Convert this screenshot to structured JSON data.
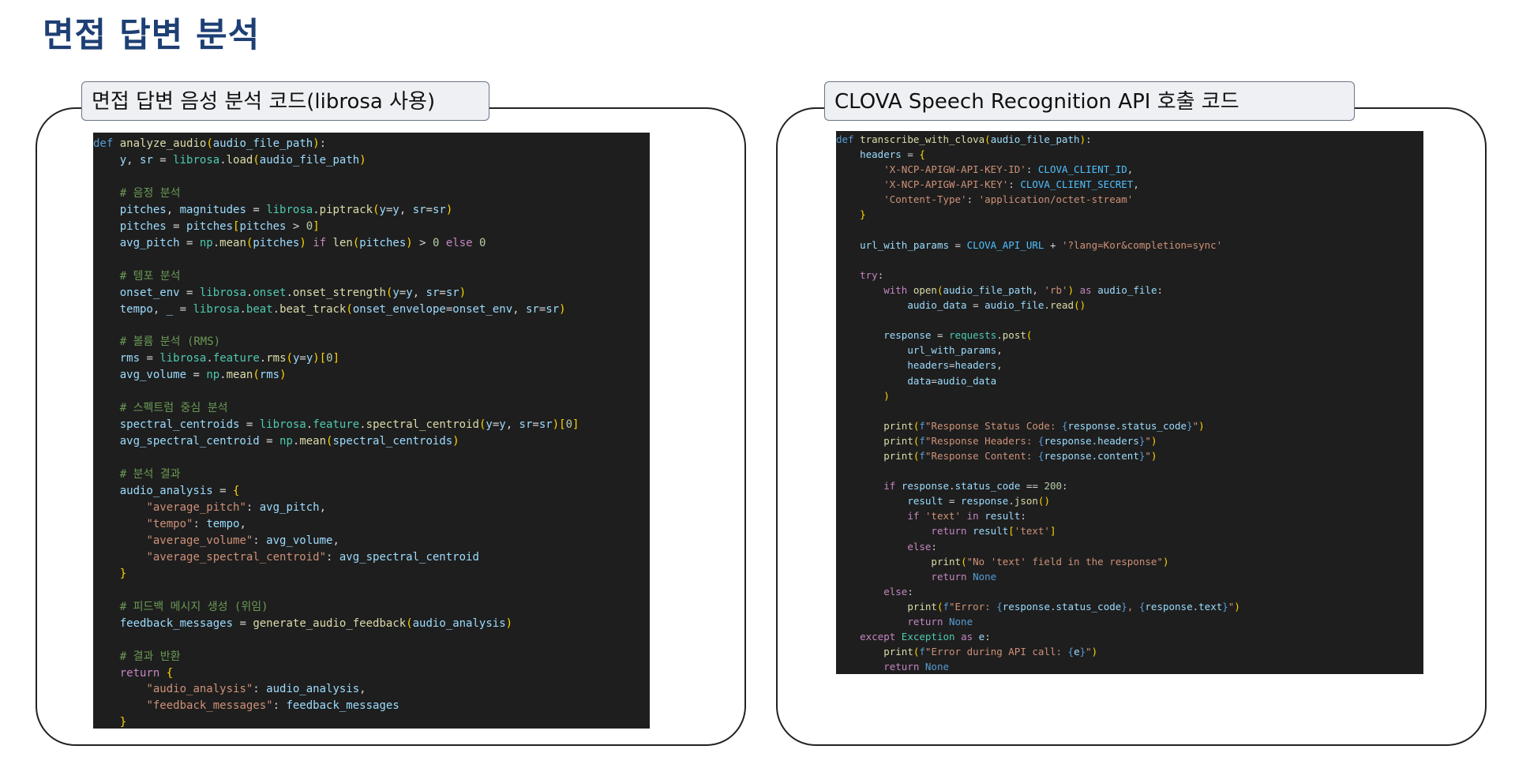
{
  "page": {
    "title": "면접 답변 분석"
  },
  "left_panel": {
    "label": "면접 답변 음성 분석 코드(librosa 사용)",
    "code_lines": [
      "def analyze_audio(audio_file_path):",
      "    y, sr = librosa.load(audio_file_path)",
      "",
      "    # 음정 분석",
      "    pitches, magnitudes = librosa.piptrack(y=y, sr=sr)",
      "    pitches = pitches[pitches > 0]",
      "    avg_pitch = np.mean(pitches) if len(pitches) > 0 else 0",
      "",
      "    # 템포 분석",
      "    onset_env = librosa.onset.onset_strength(y=y, sr=sr)",
      "    tempo, _ = librosa.beat.beat_track(onset_envelope=onset_env, sr=sr)",
      "",
      "    # 볼륨 분석 (RMS)",
      "    rms = librosa.feature.rms(y=y)[0]",
      "    avg_volume = np.mean(rms)",
      "",
      "    # 스펙트럼 중심 분석",
      "    spectral_centroids = librosa.feature.spectral_centroid(y=y, sr=sr)[0]",
      "    avg_spectral_centroid = np.mean(spectral_centroids)",
      "",
      "    # 분석 결과",
      "    audio_analysis = {",
      "        \"average_pitch\": avg_pitch,",
      "        \"tempo\": tempo,",
      "        \"average_volume\": avg_volume,",
      "        \"average_spectral_centroid\": avg_spectral_centroid",
      "    }",
      "",
      "    # 피드백 메시지 생성 (위임)",
      "    feedback_messages = generate_audio_feedback(audio_analysis)",
      "",
      "    # 결과 반환",
      "    return {",
      "        \"audio_analysis\": audio_analysis,",
      "        \"feedback_messages\": feedback_messages",
      "    }"
    ]
  },
  "right_panel": {
    "label": "CLOVA Speech Recognition API 호출 코드",
    "code_lines": [
      "def transcribe_with_clova(audio_file_path):",
      "    headers = {",
      "        'X-NCP-APIGW-API-KEY-ID': CLOVA_CLIENT_ID,",
      "        'X-NCP-APIGW-API-KEY': CLOVA_CLIENT_SECRET,",
      "        'Content-Type': 'application/octet-stream'",
      "    }",
      "",
      "    url_with_params = CLOVA_API_URL + '?lang=Kor&completion=sync'",
      "",
      "    try:",
      "        with open(audio_file_path, 'rb') as audio_file:",
      "            audio_data = audio_file.read()",
      "",
      "        response = requests.post(",
      "            url_with_params,",
      "            headers=headers,",
      "            data=audio_data",
      "        )",
      "",
      "        print(f\"Response Status Code: {response.status_code}\")",
      "        print(f\"Response Headers: {response.headers}\")",
      "        print(f\"Response Content: {response.content}\")",
      "",
      "        if response.status_code == 200:",
      "            result = response.json()",
      "            if 'text' in result:",
      "                return result['text']",
      "            else:",
      "                print(\"No 'text' field in the response\")",
      "                return None",
      "        else:",
      "            print(f\"Error: {response.status_code}, {response.text}\")",
      "            return None",
      "    except Exception as e:",
      "        print(f\"Error during API call: {e}\")",
      "        return None"
    ]
  }
}
